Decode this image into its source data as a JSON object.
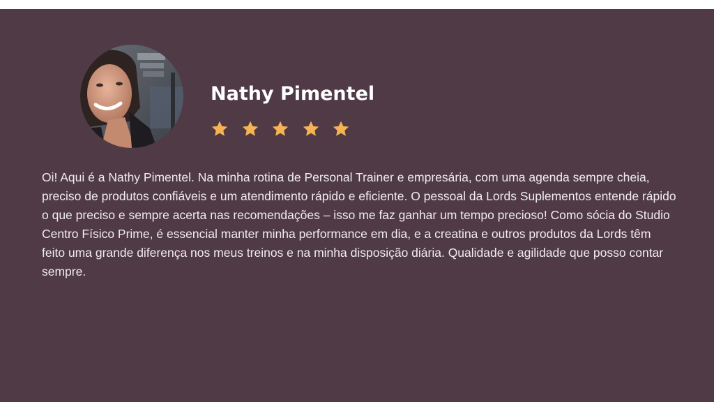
{
  "testimonial": {
    "name": "Nathy Pimentel",
    "rating": 5,
    "rating_max": 5,
    "review": "Oi! Aqui é a Nathy Pimentel. Na minha rotina de Personal Trainer e empresária, com uma agenda sempre cheia, preciso de produtos confiáveis e um atendimento rápido e eficiente. O pessoal da Lords Suplementos entende rápido o que preciso e sempre acerta nas recomendações – isso me faz ganhar um tempo precioso! Como sócia do Studio Centro Físico Prime, é essencial manter minha performance em dia, e a creatina e outros produtos da Lords têm feito uma grande diferença nos meus treinos e na minha disposição diária. Qualidade e agilidade que posso contar sempre."
  },
  "colors": {
    "background": "#4f3a45",
    "star": "#f6b354",
    "text": "#ffffff"
  },
  "icons": {
    "star": "star-icon",
    "avatar": "profile-photo"
  }
}
